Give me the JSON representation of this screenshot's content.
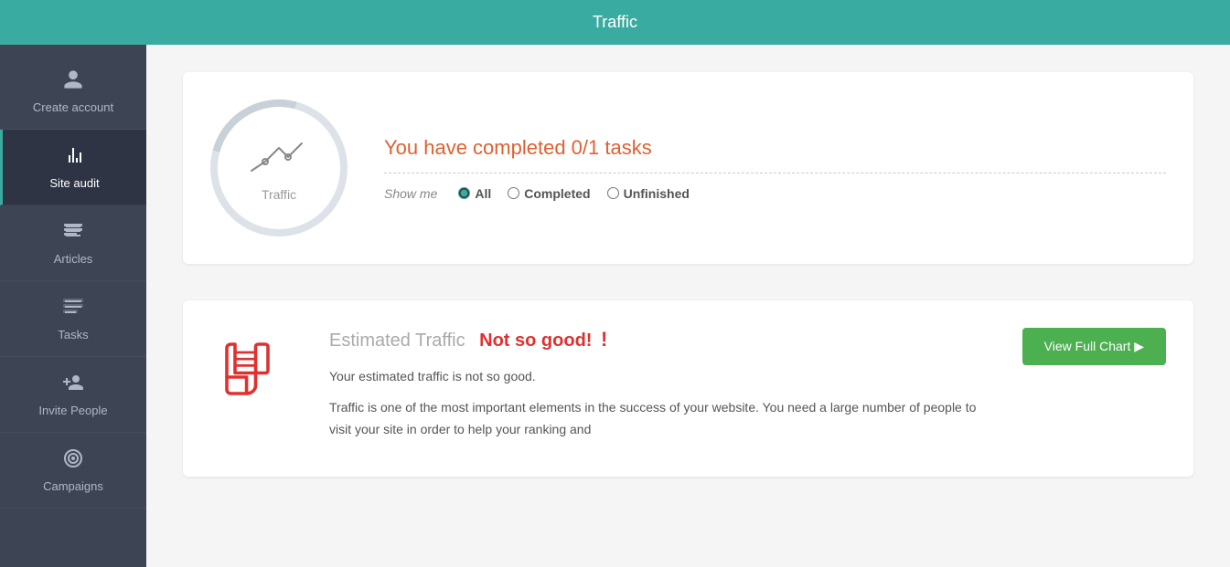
{
  "header": {
    "title": "Traffic"
  },
  "sidebar": {
    "items": [
      {
        "id": "create-account",
        "label": "Create account",
        "icon": "person"
      },
      {
        "id": "site-audit",
        "label": "Site audit",
        "icon": "bar-chart",
        "active": true
      },
      {
        "id": "articles",
        "label": "Articles",
        "icon": "articles"
      },
      {
        "id": "tasks",
        "label": "Tasks",
        "icon": "tasks"
      },
      {
        "id": "invite-people",
        "label": "Invite People",
        "icon": "person"
      },
      {
        "id": "campaigns",
        "label": "Campaigns",
        "icon": "campaigns"
      }
    ]
  },
  "task_section": {
    "circle_label": "Traffic",
    "task_title": "You have completed 0/1 tasks",
    "filter": {
      "show_me_label": "Show me",
      "options": [
        "All",
        "Completed",
        "Unfinished"
      ],
      "selected": "All"
    }
  },
  "traffic_section": {
    "title": "Estimated Traffic",
    "status": "Not so good!",
    "exclaim": "!",
    "desc1": "Your estimated traffic is not so good.",
    "desc2": "Traffic is one of the most important elements in the success of your website. You need a large number of people to visit your site in order to help your ranking and",
    "cta_label": "View Full Chart ▶"
  }
}
